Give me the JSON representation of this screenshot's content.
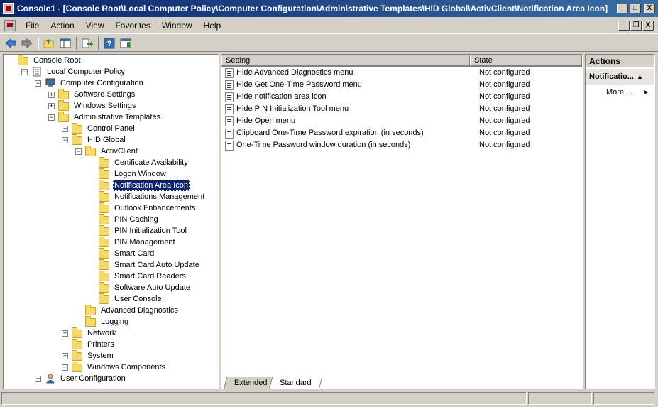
{
  "window": {
    "title": "Console1 - [Console Root\\Local Computer Policy\\Computer Configuration\\Administrative Templates\\HID Global\\ActivClient\\Notification Area Icon]",
    "minimize": "_",
    "maximize": "□",
    "close": "X"
  },
  "menu": {
    "items": [
      "File",
      "Action",
      "View",
      "Favorites",
      "Window",
      "Help"
    ],
    "mdi_minimize": "_",
    "mdi_restore": "❐",
    "mdi_close": "X"
  },
  "toolbar": {
    "icons": [
      "back-icon",
      "forward-icon",
      "up-folder-icon",
      "show-hide-tree-icon",
      "export-list-icon",
      "help-icon",
      "show-hide-action-pane-icon"
    ]
  },
  "tree": {
    "nodes": [
      {
        "label": "Console Root",
        "level": 0,
        "expander": "",
        "icon": "folder"
      },
      {
        "label": "Local Computer Policy",
        "level": 1,
        "expander": "−",
        "icon": "policy"
      },
      {
        "label": "Computer Configuration",
        "level": 2,
        "expander": "−",
        "icon": "computer"
      },
      {
        "label": "Software Settings",
        "level": 3,
        "expander": "+",
        "icon": "folder"
      },
      {
        "label": "Windows Settings",
        "level": 3,
        "expander": "+",
        "icon": "folder"
      },
      {
        "label": "Administrative Templates",
        "level": 3,
        "expander": "−",
        "icon": "folder"
      },
      {
        "label": "Control Panel",
        "level": 4,
        "expander": "+",
        "icon": "folder"
      },
      {
        "label": "HID Global",
        "level": 4,
        "expander": "−",
        "icon": "folder"
      },
      {
        "label": "ActivClient",
        "level": 5,
        "expander": "−",
        "icon": "folder"
      },
      {
        "label": "Certificate Availability",
        "level": 6,
        "expander": "",
        "icon": "folder"
      },
      {
        "label": "Logon Window",
        "level": 6,
        "expander": "",
        "icon": "folder"
      },
      {
        "label": "Notification Area Icon",
        "level": 6,
        "expander": "",
        "icon": "folder",
        "selected": true
      },
      {
        "label": "Notifications Management",
        "level": 6,
        "expander": "",
        "icon": "folder"
      },
      {
        "label": "Outlook Enhancements",
        "level": 6,
        "expander": "",
        "icon": "folder"
      },
      {
        "label": "PIN Caching",
        "level": 6,
        "expander": "",
        "icon": "folder"
      },
      {
        "label": "PIN Initialization Tool",
        "level": 6,
        "expander": "",
        "icon": "folder"
      },
      {
        "label": "PIN Management",
        "level": 6,
        "expander": "",
        "icon": "folder"
      },
      {
        "label": "Smart Card",
        "level": 6,
        "expander": "",
        "icon": "folder"
      },
      {
        "label": "Smart Card Auto Update",
        "level": 6,
        "expander": "",
        "icon": "folder"
      },
      {
        "label": "Smart Card Readers",
        "level": 6,
        "expander": "",
        "icon": "folder"
      },
      {
        "label": "Software Auto Update",
        "level": 6,
        "expander": "",
        "icon": "folder"
      },
      {
        "label": "User Console",
        "level": 6,
        "expander": "",
        "icon": "folder"
      },
      {
        "label": "Advanced Diagnostics",
        "level": 5,
        "expander": "",
        "icon": "folder"
      },
      {
        "label": "Logging",
        "level": 5,
        "expander": "",
        "icon": "folder"
      },
      {
        "label": "Network",
        "level": 4,
        "expander": "+",
        "icon": "folder"
      },
      {
        "label": "Printers",
        "level": 4,
        "expander": "",
        "icon": "folder"
      },
      {
        "label": "System",
        "level": 4,
        "expander": "+",
        "icon": "folder"
      },
      {
        "label": "Windows Components",
        "level": 4,
        "expander": "+",
        "icon": "folder"
      },
      {
        "label": "User Configuration",
        "level": 2,
        "expander": "+",
        "icon": "user"
      }
    ]
  },
  "list": {
    "columns": {
      "setting": "Setting",
      "state": "State"
    },
    "rows": [
      {
        "setting": "Hide Advanced Diagnostics menu",
        "state": "Not configured"
      },
      {
        "setting": "Hide Get One-Time Password menu",
        "state": "Not configured"
      },
      {
        "setting": "Hide notification area icon",
        "state": "Not configured"
      },
      {
        "setting": "Hide PIN Initialization Tool menu",
        "state": "Not configured"
      },
      {
        "setting": "Hide Open menu",
        "state": "Not configured"
      },
      {
        "setting": "Clipboard One-Time Password expiration (in seconds)",
        "state": "Not configured"
      },
      {
        "setting": "One-Time Password window duration (in seconds)",
        "state": "Not configured"
      }
    ]
  },
  "tabs": {
    "extended": "Extended",
    "standard": "Standard"
  },
  "actions": {
    "header": "Actions",
    "section": "Notificatio...",
    "section_arrow": "▲",
    "more": "More ...",
    "more_arrow": "▶"
  }
}
